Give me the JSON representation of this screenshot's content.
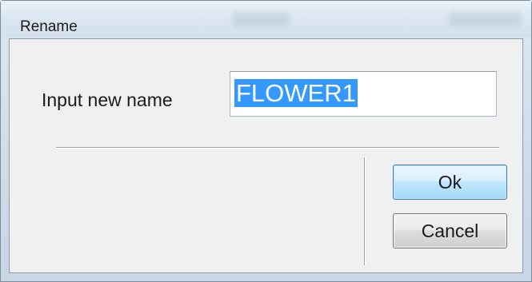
{
  "dialog": {
    "title": "Rename"
  },
  "form": {
    "label": "Input new name",
    "value": "FLOWER1"
  },
  "buttons": {
    "ok": "Ok",
    "cancel": "Cancel"
  },
  "colors": {
    "selection": "#3399ff",
    "ok_border": "#3c7fb1"
  }
}
